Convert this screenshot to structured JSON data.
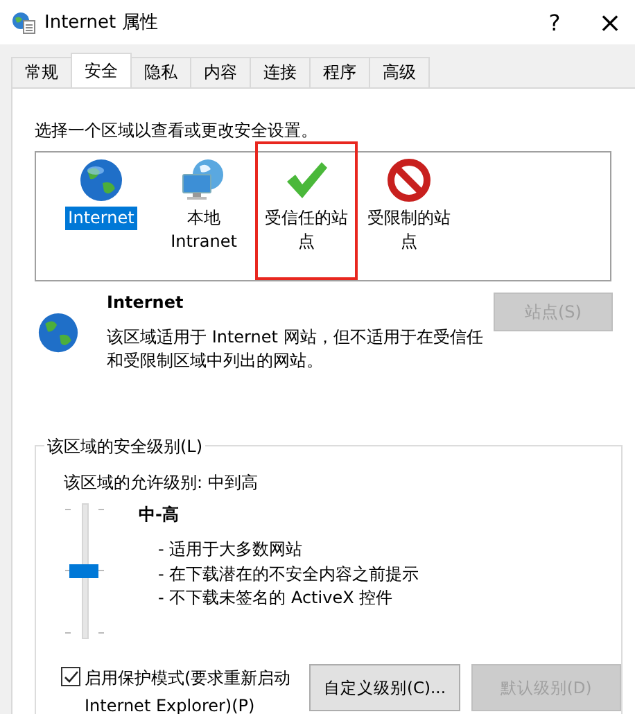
{
  "window": {
    "title": "Internet 属性",
    "help": "?",
    "close": "×"
  },
  "tabs": [
    {
      "label": "常规",
      "selected": false
    },
    {
      "label": "安全",
      "selected": true
    },
    {
      "label": "隐私",
      "selected": false
    },
    {
      "label": "内容",
      "selected": false
    },
    {
      "label": "连接",
      "selected": false
    },
    {
      "label": "程序",
      "selected": false
    },
    {
      "label": "高级",
      "selected": false
    }
  ],
  "zone_prompt": "选择一个区域以查看或更改安全设置。",
  "zones": [
    {
      "kind": "internet",
      "label": "Internet",
      "selected": true,
      "highlighted": false
    },
    {
      "kind": "intranet",
      "label": "本地\nIntranet",
      "selected": false,
      "highlighted": false
    },
    {
      "kind": "trusted",
      "label": "受信任的站点",
      "selected": false,
      "highlighted": true
    },
    {
      "kind": "restricted",
      "label": "受限制的站点",
      "selected": false,
      "highlighted": false
    }
  ],
  "zone_info": {
    "title": "Internet",
    "description": "该区域适用于 Internet 网站，但不适用于在受信任和受限制区域中列出的网站。",
    "sites_button": {
      "label": "站点(S)",
      "disabled": true
    }
  },
  "security_level": {
    "legend": "该区域的安全级别(L)",
    "allowed": "该区域的允许级别: 中到高",
    "level": 0.5,
    "level_name": "中-高",
    "bullets": [
      "- 适用于大多数网站",
      "- 在下载潜在的不安全内容之前提示",
      "- 不下载未签名的 ActiveX 控件"
    ],
    "protected_mode": {
      "label": "启用保护模式(要求重新启动\nInternet Explorer)(P)",
      "checked": true
    },
    "buttons": [
      {
        "label": "自定义级别(C)...",
        "disabled": false
      },
      {
        "label": "默认级别(D)",
        "disabled": true
      }
    ]
  }
}
